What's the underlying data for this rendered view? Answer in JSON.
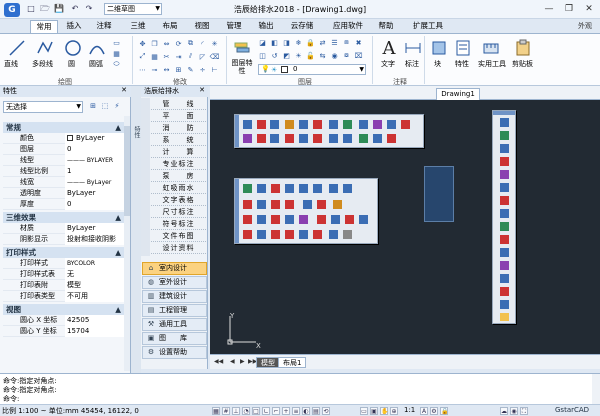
{
  "app": {
    "logo_glyph": "G",
    "window_title": "浩辰给排水2018 - [Drawing1.dwg]",
    "workspace": "二维草图",
    "quick_access": [
      "□",
      "🗁",
      "💾",
      "↶",
      "↷"
    ],
    "window_buttons": [
      "—",
      "❐",
      "✕"
    ]
  },
  "ribbon": {
    "tabs": [
      "常用",
      "插入",
      "注释",
      "三维",
      "布局",
      "视图",
      "管理",
      "输出",
      "云存储",
      "应用软件",
      "帮助",
      "扩展工具"
    ],
    "active_tab": "常用",
    "outline_label": "外观",
    "draw_group": {
      "label": "绘图",
      "buttons": [
        "直线",
        "多段线",
        "圆",
        "圆弧"
      ]
    },
    "modify_group": {
      "label": "修改"
    },
    "layer_group": {
      "label": "图层",
      "properties_label": "图层特性"
    },
    "annotation_group": {
      "label": "注释",
      "buttons": [
        "文字",
        "标注"
      ]
    },
    "other_buttons": [
      "块",
      "特性",
      "实用工具",
      "剪贴板"
    ]
  },
  "properties": {
    "title": "特性",
    "close": "✕",
    "selection": "无选择",
    "sections": [
      {
        "name": "常规",
        "rows": [
          [
            "颜色",
            "ByLayer"
          ],
          [
            "图层",
            "0"
          ],
          [
            "线型",
            "——— BYLAYER"
          ],
          [
            "线型比例",
            "1"
          ],
          [
            "线宽",
            "——— ByLayer"
          ],
          [
            "透明度",
            "ByLayer"
          ],
          [
            "厚度",
            "0"
          ]
        ]
      },
      {
        "name": "三维效果",
        "rows": [
          [
            "材质",
            "ByLayer"
          ],
          [
            "阴影显示",
            "投射和接收阴影"
          ]
        ]
      },
      {
        "name": "打印样式",
        "rows": [
          [
            "打印样式",
            "BYCOLOR"
          ],
          [
            "打印样式表",
            "无"
          ],
          [
            "打印表附",
            "模型"
          ],
          [
            "打印表类型",
            "不可用"
          ]
        ]
      },
      {
        "name": "视图",
        "rows": [
          [
            "圆心 X 坐标",
            "42505"
          ],
          [
            "圆心 Y 坐标",
            "15704"
          ]
        ]
      }
    ]
  },
  "toolpanel": {
    "title": "浩辰给排水",
    "close": "✕",
    "categories": [
      "管　　线",
      "平　　面",
      "消　　防",
      "系　　统",
      "计　　算",
      "专业标注",
      "泵　　房",
      "虹吸雨水",
      "文字表格",
      "尺寸标注",
      "符号标注",
      "文件布图",
      "设计资料"
    ],
    "buttons": [
      "室内设计",
      "室外设计",
      "建筑设计",
      "工程管理",
      "通用工具",
      "图　　库",
      "设置帮助"
    ],
    "active_button": "室内设计"
  },
  "drawing": {
    "tab": "Drawing1",
    "layout_tabs": [
      "模型",
      "布局1"
    ],
    "active_layout": "模型",
    "ucs_x": "X",
    "ucs_y": "Y"
  },
  "command": {
    "lines": [
      "命令:指定对角点:",
      "命令:指定对角点:",
      "命令:"
    ]
  },
  "status": {
    "text": "比例 1:100 ~ 单位:mm  45454, 16122, 0",
    "right_text": "GstarCAD",
    "scale": "1:1"
  }
}
